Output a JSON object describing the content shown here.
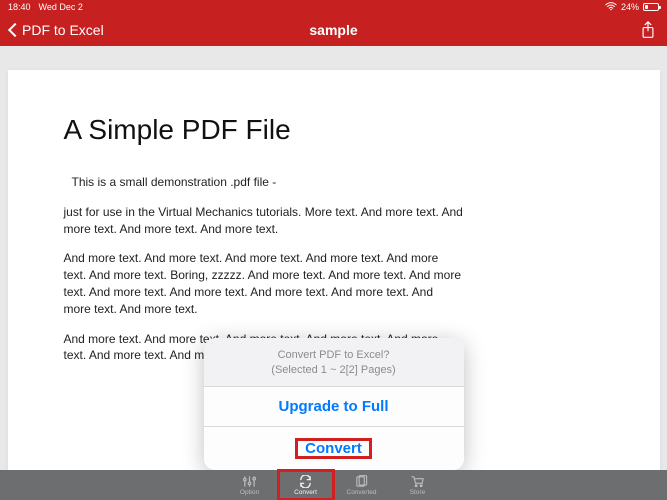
{
  "status": {
    "time": "18:40",
    "date": "Wed Dec 2",
    "battery_pct": "24%"
  },
  "nav": {
    "back_label": "PDF to Excel",
    "title": "sample"
  },
  "document": {
    "title": "A Simple PDF File",
    "paragraphs": [
      "This is a small demonstration .pdf file -",
      "just for use in the Virtual Mechanics tutorials. More text. And more text. And more text. And more text. And more text.",
      "And more text. And more text. And more text. And more text. And more text. And more text. Boring, zzzzz. And more text. And more text. And more text. And more text. And more text. And more text. And more text. And more text. And more text.",
      "And more text. And more text. And more text. And more text. And more text. And more text. And more text. Even more. Continued on page 2 ..."
    ]
  },
  "sheet": {
    "line1": "Convert PDF to Excel?",
    "line2": "(Selected 1 ~ 2[2] Pages)",
    "upgrade": "Upgrade to Full",
    "convert": "Convert"
  },
  "tabs": {
    "option": "Option",
    "convert": "Convert",
    "converted": "Converted",
    "store": "Store"
  }
}
